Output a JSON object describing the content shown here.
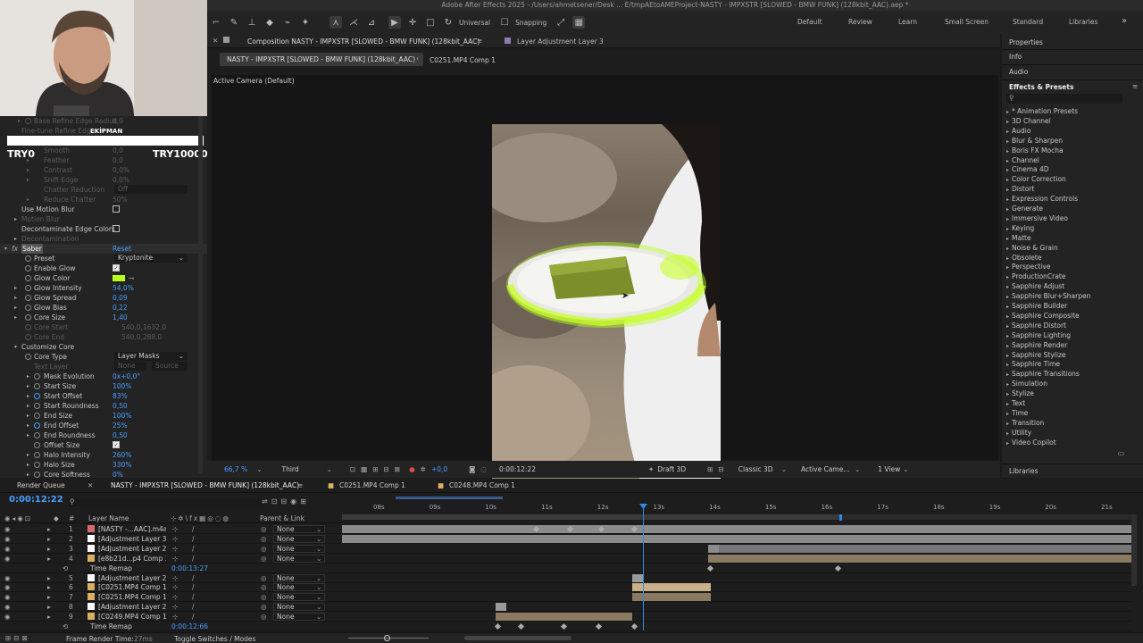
{
  "app": {
    "title": "Adobe After Effects 2025 - /Users/ahmetsener/Desk ... E/tmpAEtoAMEProject-NASTY - IMPXSTR [SLOWED - BMW FUNK] (128kbit_AAC).aep *"
  },
  "toolbar": {
    "universal": "Universal",
    "snapping": "Snapping"
  },
  "workspaces": [
    "Default",
    "Review",
    "Learn",
    "Small Screen",
    "Standard",
    "Libraries"
  ],
  "overlay": {
    "banner": "EKİPMAN",
    "left_price": "TRY0",
    "right_price": "TRY10000"
  },
  "effect_controls": {
    "top_rows": [
      {
        "label": "Base Refine Edge Radius",
        "value": "0,0",
        "dim": true
      },
      {
        "label": "Fine-tune Refine Edge",
        "value": "",
        "dim": true
      },
      {
        "label": "Smooth",
        "value": "0,0",
        "dim": true
      },
      {
        "label": "Feather",
        "value": "0,0",
        "dim": true
      },
      {
        "label": "Contrast",
        "value": "0,0%",
        "dim": true
      },
      {
        "label": "Shift Edge",
        "value": "0,0%",
        "dim": true
      },
      {
        "label": "Chatter Reduction",
        "value": "Off",
        "dim": true
      },
      {
        "label": "Reduce Chatter",
        "value": "50%",
        "dim": true
      }
    ],
    "use_motion_blur": "Use Motion Blur",
    "motion_blur": "Motion Blur",
    "decontaminate": "Decontaminate Edge Colors",
    "decontamination": "Decontamination",
    "saber": "Saber",
    "reset": "Reset",
    "preset": "Preset",
    "preset_value": "Kryptonite",
    "enable_glow": "Enable Glow",
    "glow_color": "Glow Color",
    "glow_color_hex": "#b5ff1a",
    "params": [
      {
        "label": "Glow Intensity",
        "value": "54,0%"
      },
      {
        "label": "Glow Spread",
        "value": "0,09"
      },
      {
        "label": "Glow Bias",
        "value": "0,22"
      },
      {
        "label": "Core Size",
        "value": "1,40"
      },
      {
        "label": "Core Start",
        "value": "540,0,1632,0",
        "dim": true
      },
      {
        "label": "Core End",
        "value": "540,0,288,0",
        "dim": true
      }
    ],
    "customize_core": "Customize Core",
    "core_type": "Core Type",
    "core_type_value": "Layer Masks",
    "text_layer": "Text Layer",
    "text_layer_value": "None",
    "text_layer_source": "Source",
    "params2": [
      {
        "label": "Mask Evolution",
        "value": "0x+0,0°"
      },
      {
        "label": "Start Size",
        "value": "100%"
      },
      {
        "label": "Start Offset",
        "value": "83%"
      },
      {
        "label": "Start Roundness",
        "value": "0,50"
      },
      {
        "label": "End Size",
        "value": "100%"
      },
      {
        "label": "End Offset",
        "value": "25%"
      },
      {
        "label": "End Roundness",
        "value": "0,50"
      }
    ],
    "offset_size": "Offset Size",
    "params3": [
      {
        "label": "Halo Intensity",
        "value": "260%"
      },
      {
        "label": "Halo Size",
        "value": "330%"
      },
      {
        "label": "Core Softness",
        "value": "0%"
      }
    ]
  },
  "composition": {
    "tab": "Composition NASTY - IMPXSTR [SLOWED - BMW FUNK] (128kbit_AAC)",
    "layer_tab": "Layer Adjustment Layer 3",
    "crumb1": "NASTY - IMPXSTR [SLOWED - BMW FUNK] (128kbit_AAC)",
    "crumb2": "C0251.MP4 Comp 1",
    "camera": "Active Camera (Default)",
    "zoom": "66,7 %",
    "resolution": "Third",
    "exposure": "+0,0",
    "timecode": "0:00:12:22",
    "draft": "Draft 3D",
    "renderer": "Classic 3D",
    "camera_sel": "Active Came...",
    "views": "1 View"
  },
  "right_panel": {
    "properties": "Properties",
    "info": "Info",
    "audio": "Audio",
    "effects_title": "Effects & Presets",
    "search_placeholder": "",
    "effects": [
      "* Animation Presets",
      "3D Channel",
      "Audio",
      "Blur & Sharpen",
      "Boris FX Mocha",
      "Channel",
      "Cinema 4D",
      "Color Correction",
      "Distort",
      "Expression Controls",
      "Generate",
      "Immersive Video",
      "Keying",
      "Matte",
      "Noise & Grain",
      "Obsolete",
      "Perspective",
      "ProductionCrate",
      "Sapphire Adjust",
      "Sapphire Blur+Sharpen",
      "Sapphire Builder",
      "Sapphire Composite",
      "Sapphire Distort",
      "Sapphire Lighting",
      "Sapphire Render",
      "Sapphire Stylize",
      "Sapphire Time",
      "Sapphire Transitions",
      "Simulation",
      "Stylize",
      "Text",
      "Time",
      "Transition",
      "Utility",
      "Video Copilot"
    ],
    "libraries": "Libraries"
  },
  "timeline": {
    "render_queue": "Render Queue",
    "tabs": [
      "NASTY - IMPXSTR [SLOWED - BMW FUNK] (128kbit_AAC)",
      "C0251.MP4 Comp 1",
      "C0248.MP4 Comp 1"
    ],
    "timecode": "0:00:12:22",
    "col_layer": "Layer Name",
    "col_parent": "Parent & Link",
    "ruler": [
      "08s",
      "09s",
      "10s",
      "11s",
      "12s",
      "13s",
      "14s",
      "15s",
      "16s",
      "17s",
      "18s",
      "19s",
      "20s",
      "21s"
    ],
    "layers": [
      {
        "num": "1",
        "name": "[NASTY -...AAC].m4a]",
        "parent": "None",
        "color": "#d96a6a"
      },
      {
        "num": "2",
        "name": "[Adjustment Layer 3]",
        "parent": "None",
        "color": "#ffffff"
      },
      {
        "num": "3",
        "name": "[Adjustment Layer 2]",
        "parent": "None",
        "color": "#ffffff"
      },
      {
        "num": "4",
        "name": "[e8b21d...p4 Comp 3]",
        "parent": "None",
        "color": "#d9b060"
      },
      {
        "num": "",
        "name": "Time Remap",
        "parent": "0:00:13:27",
        "color": ""
      },
      {
        "num": "5",
        "name": "[Adjustment Layer 2]",
        "parent": "None",
        "color": "#ffffff"
      },
      {
        "num": "6",
        "name": "[C0251.MP4 Comp 1]",
        "parent": "None",
        "color": "#d9b060"
      },
      {
        "num": "7",
        "name": "[C0251.MP4 Comp 1]",
        "parent": "None",
        "color": "#d9b060"
      },
      {
        "num": "8",
        "name": "[Adjustment Layer 2]",
        "parent": "None",
        "color": "#ffffff"
      },
      {
        "num": "9",
        "name": "[C0249.MP4 Comp 1]",
        "parent": "None",
        "color": "#d9b060"
      },
      {
        "num": "",
        "name": "Time Remap",
        "parent": "0:00:12:66",
        "color": ""
      }
    ],
    "frame_render": "Frame Render Time:",
    "frame_render_val": "27ms",
    "toggle": "Toggle Switches / Modes"
  }
}
